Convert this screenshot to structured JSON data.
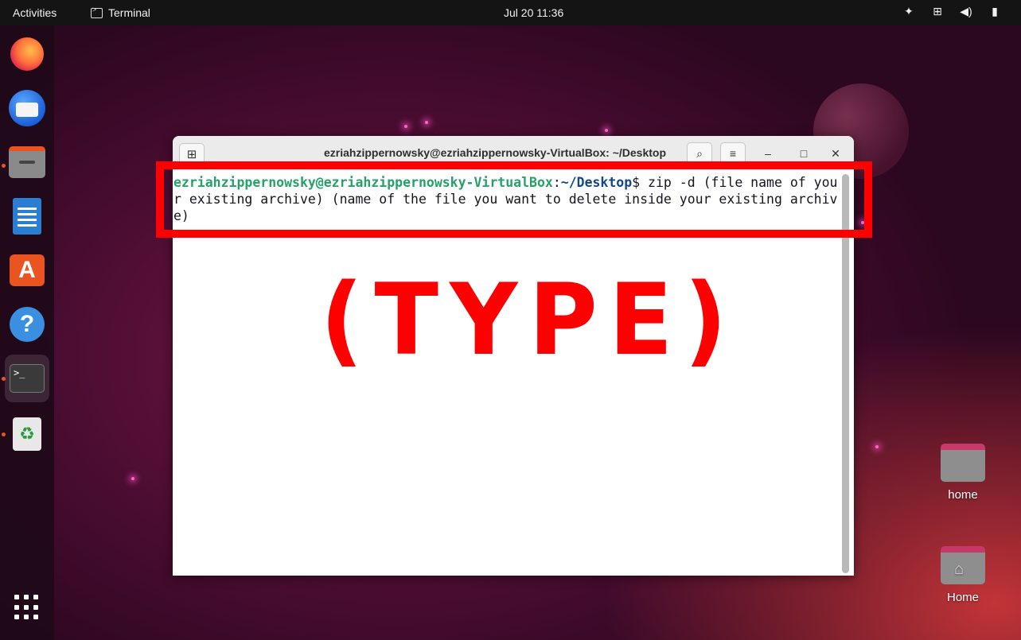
{
  "topbar": {
    "activities": "Activities",
    "app_name": "Terminal",
    "clock": "Jul 20  11:36"
  },
  "dock": {
    "items": [
      "firefox",
      "thunderbird",
      "files",
      "libreoffice-writer",
      "ubuntu-software",
      "help",
      "terminal",
      "trash"
    ]
  },
  "terminal": {
    "title": "ezriahzippernowsky@ezriahzippernowsky-VirtualBox: ~/Desktop",
    "prompt_user": "ezriahzippernowsky@ezriahzippernowsky-VirtualBox",
    "prompt_sep": ":",
    "prompt_path": "~/Desktop",
    "prompt_symbol": "$",
    "command": " zip -d (file name of your existing archive) (name of the file you want to delete inside your existing archive)"
  },
  "annotation": {
    "label": "(TYPE)",
    "color": "#ff0000"
  },
  "desktop": {
    "icons": [
      {
        "label": "home"
      },
      {
        "label": "Home"
      }
    ]
  }
}
